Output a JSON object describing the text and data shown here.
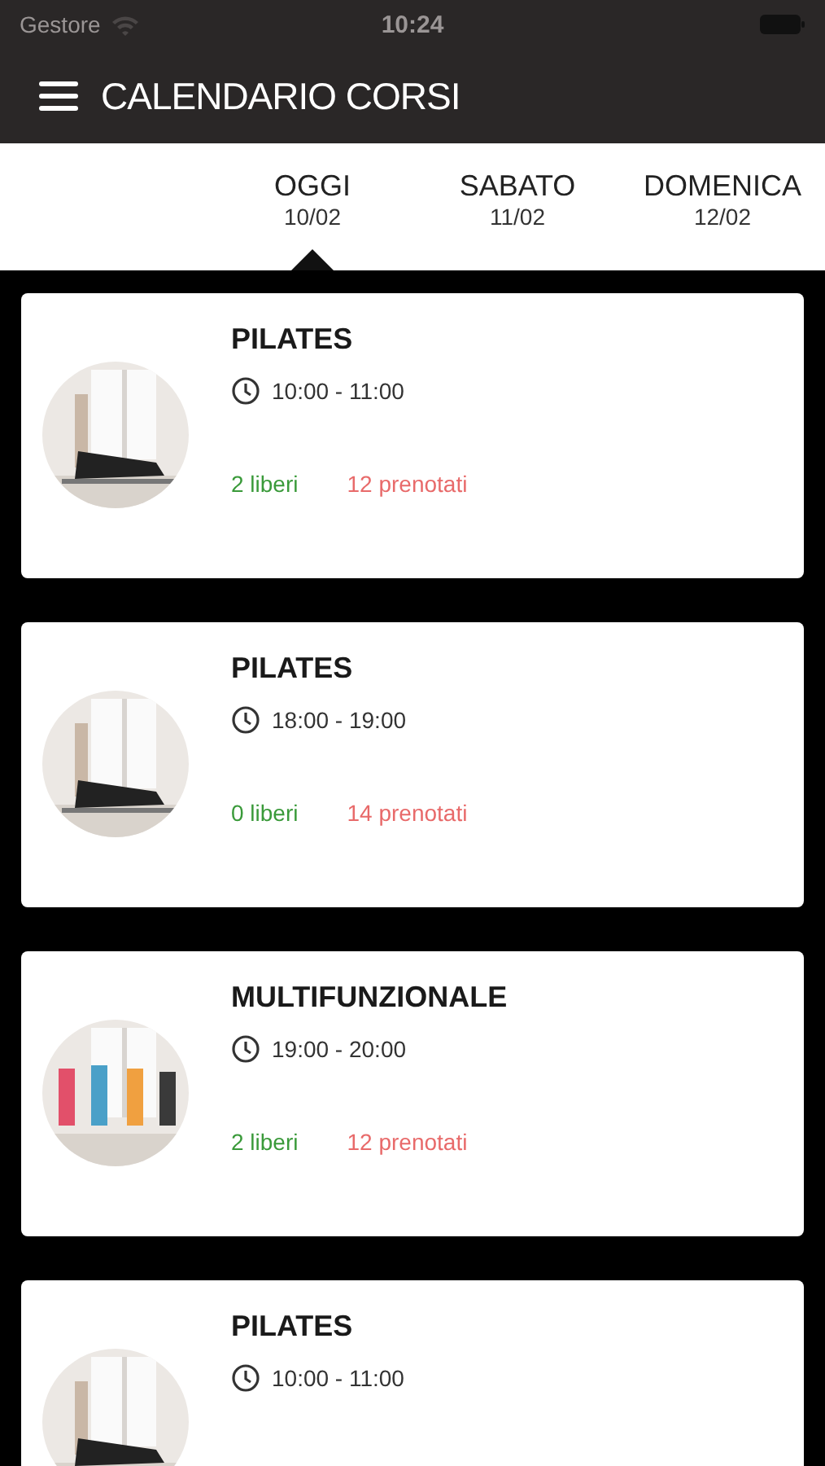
{
  "status_bar": {
    "carrier": "Gestore",
    "time": "10:24"
  },
  "header": {
    "title": "CALENDARIO CORSI"
  },
  "tabs": [
    {
      "label": "OGGI",
      "date": "10/02",
      "selected": true
    },
    {
      "label": "SABATO",
      "date": "11/02",
      "selected": false
    },
    {
      "label": "DOMENICA",
      "date": "12/02",
      "selected": false
    }
  ],
  "courses": [
    {
      "name": "PILATES",
      "time": "10:00 - 11:00",
      "free": "2 liberi",
      "booked": "12 prenotati"
    },
    {
      "name": "PILATES",
      "time": "18:00 - 19:00",
      "free": "0 liberi",
      "booked": "14 prenotati"
    },
    {
      "name": "MULTIFUNZIONALE",
      "time": "19:00 - 20:00",
      "free": "2 liberi",
      "booked": "12 prenotati"
    },
    {
      "name": "PILATES",
      "time": "10:00 - 11:00"
    }
  ]
}
